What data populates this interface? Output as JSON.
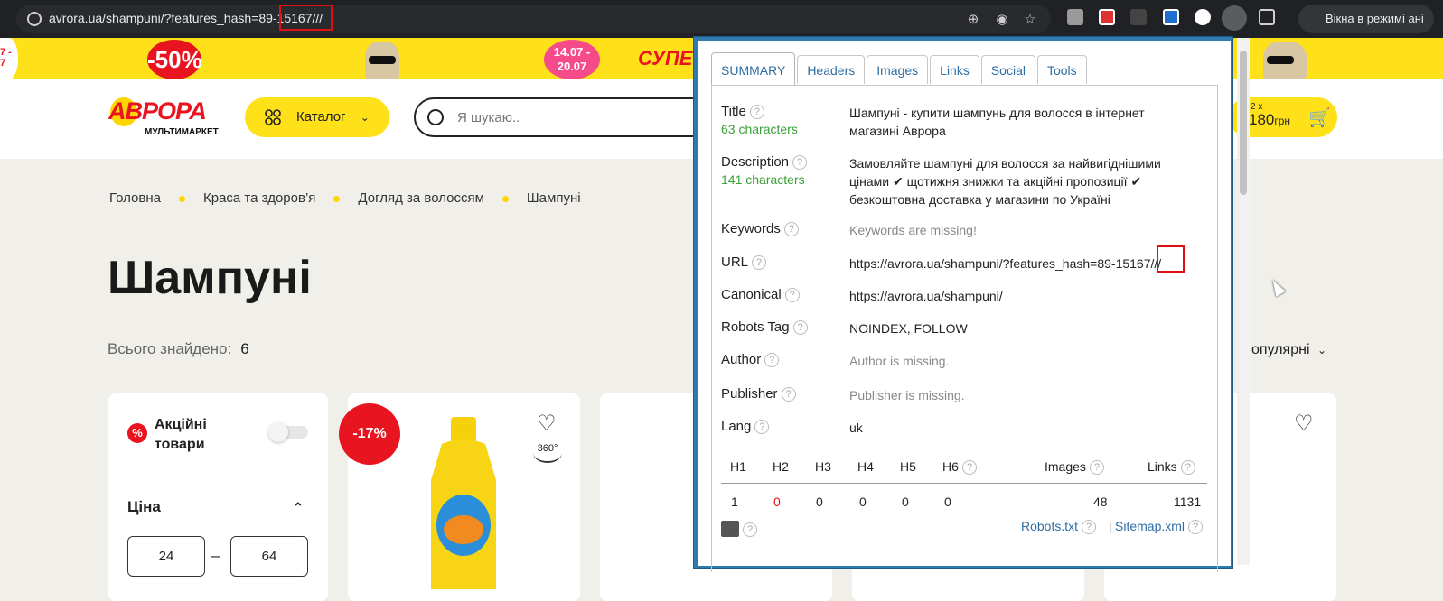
{
  "browser": {
    "url": "avrora.ua/shampuni/?features_hash=89-15167///",
    "incognito_label": "Вікна в режимі ані",
    "icons": [
      "site-info-icon",
      "zoom-icon",
      "eye-off-icon",
      "star-icon",
      "camera-icon",
      "calendar-ext-icon",
      "wand-ext-icon",
      "shield-ext-icon",
      "translate-ext-icon",
      "seo-ext-icon",
      "puzzle-icon",
      "incognito-icon"
    ]
  },
  "promo": {
    "sale": "-50%",
    "dates": "14.07 - 20.07",
    "super": "СУПЕ",
    "left_partial": "7 - 7"
  },
  "header": {
    "logo": "АВРОРА",
    "logo_sub": "МУЛЬТИМАРКЕТ",
    "catalog": "Каталог",
    "search_placeholder": "Я шукаю..",
    "cart_qty": "2 x",
    "cart_price": "180",
    "cart_currency": "грн"
  },
  "breadcrumbs": [
    "Головна",
    "Краса та здоров’я",
    "Догляд за волоссям",
    "Шампуні"
  ],
  "page": {
    "title": "Шампуні",
    "found_label": "Всього знайдено:",
    "found_count": "6",
    "sort_label": "опулярні"
  },
  "filter": {
    "promo_label": "Акційні товари",
    "price_label": "Ціна",
    "price_min": "24",
    "price_max": "64",
    "dash": "–"
  },
  "product": {
    "discount": "-17%",
    "label_360": "360°"
  },
  "seo_popup": {
    "tabs": [
      "SUMMARY",
      "Headers",
      "Images",
      "Links",
      "Social",
      "Tools"
    ],
    "rows": {
      "title": {
        "label": "Title",
        "sub": "63 characters",
        "value": "Шампуні - купити шампунь для волосся в інтернет магазині Аврора"
      },
      "description": {
        "label": "Description",
        "sub": "141 characters",
        "value": "Замовляйте шампуні для волосся за найвигіднішими цінами ✔ щотижня знижки та акційні пропозиції ✔ безкоштовна доставка у магазини по Україні"
      },
      "keywords": {
        "label": "Keywords",
        "value": "Keywords are missing!"
      },
      "url": {
        "label": "URL",
        "value": "https://avrora.ua/shampuni/?features_hash=89-15167///"
      },
      "canonical": {
        "label": "Canonical",
        "value": "https://avrora.ua/shampuni/"
      },
      "robots": {
        "label": "Robots Tag",
        "value": "NOINDEX, FOLLOW"
      },
      "author": {
        "label": "Author",
        "value": "Author is missing."
      },
      "publisher": {
        "label": "Publisher",
        "value": "Publisher is missing."
      },
      "lang": {
        "label": "Lang",
        "value": "uk"
      }
    },
    "headings": {
      "cols": [
        "H1",
        "H2",
        "H3",
        "H4",
        "H5",
        "H6",
        "Images",
        "Links"
      ],
      "vals": [
        "1",
        "0",
        "0",
        "0",
        "0",
        "0",
        "48",
        "1131"
      ]
    },
    "footer": {
      "robots": "Robots.txt",
      "sep": "|",
      "sitemap": "Sitemap.xml"
    },
    "help_glyph": "?"
  },
  "colors": {
    "accent": "#ffe11a",
    "brand_red": "#e8141f",
    "link": "#2e6da4",
    "green": "#3aa036"
  }
}
